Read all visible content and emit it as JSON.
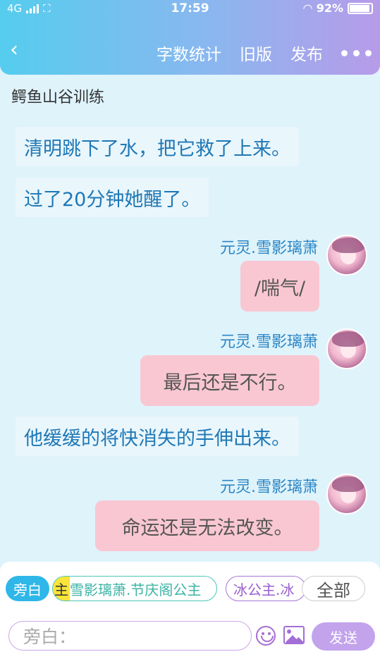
{
  "status_bar": {
    "network": "4G",
    "time": "17:59",
    "battery": "92%"
  },
  "header": {
    "actions": [
      "字数统计",
      "旧版",
      "发布"
    ]
  },
  "story_title": "鳄鱼山谷训练",
  "messages": [
    {
      "type": "narration",
      "text": "清明跳下了水，把它救了上来。"
    },
    {
      "type": "narration",
      "text": "过了20分钟她醒了。"
    },
    {
      "type": "user",
      "name": "元灵.雪影璃萧",
      "text": "/喘气/"
    },
    {
      "type": "user",
      "name": "元灵.雪影璃萧",
      "text": "最后还是不行。"
    },
    {
      "type": "narration",
      "text": "他缓缓的将快消失的手伸出来。"
    },
    {
      "type": "user",
      "name": "元灵.雪影璃萧",
      "text": "命运还是无法改变。"
    }
  ],
  "roles": {
    "narration": "旁白",
    "main_tag": "主",
    "main": "雪影璃萧.节庆阁公主",
    "ice": "冰公主.冰",
    "all": "全部"
  },
  "input": {
    "placeholder": "旁白："
  },
  "send_label": "发送",
  "colors": {
    "header_start": "#55cdee",
    "header_end": "#b79be9",
    "narration_text": "#1f78b5",
    "user_bubble": "#f9c7d2",
    "send_button": "#c2a3ec"
  }
}
